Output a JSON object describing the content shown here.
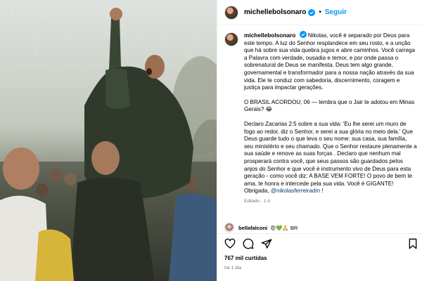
{
  "post": {
    "username": "michellebolsonaro",
    "follow_label": "Seguir",
    "separator": "•",
    "caption_paragraphs": [
      "Nikolas, você é separado por Deus para este tempo. A luz do Senhor resplandece em seu rosto, e a unção que há sobre sua vida quebra jugos e abre caminhos. Você carrega a Palavra com verdade, ousadia e temor, e por onde passa o sobrenatural de Deus se manifesta. Deus tem algo grande, governamental e transformador para a nossa nação através da sua vida. Ele te conduz com sabedoria, discernimento, coragem e justiça para impactar gerações.",
      "O BRASIL ACORDOU, 06 — lembra que o Jair te adotou em Minas Gerais? 😂",
      "Declaro Zacarias 2:5 sobre a sua vida: 'Eu lhe serei um muro de fogo ao redor, diz o Senhor, e serei a sua glória no meio dela.' Que Deus guarde tudo o que leva o seu nome: sua casa, sua família, seu ministério e seu chamado. Que o Senhor restaure plenamente a sua saúde e renove as suas forças . Declaro que nenhum mal prosperará contra você, que seus passos são guardados pelos anjos do Senhor e que você é instrumento vivo de Deus para esta geração - como você diz: A BASE VEM FORTE! O povo de bem te ama, te honra e intercede pela sua vida. Você é GIGANTE! Obrigada,"
    ],
    "mention": "@nikolasferreiradm",
    "caption_end": " !",
    "edited_label": "Editado · 1 d",
    "likes": "767 mil curtidas",
    "time_ago": "há 1 dia"
  },
  "comment": {
    "username": "bellafalconi",
    "text": "😍💚🙏 BR"
  },
  "icons": {
    "like": "heart-icon",
    "comment": "comment-icon",
    "share": "share-icon",
    "save": "bookmark-icon",
    "verified": "verified-badge-icon"
  },
  "colors": {
    "link": "#0095f6",
    "mention": "#00376b",
    "verified": "#0095f6",
    "muted": "#737373"
  }
}
